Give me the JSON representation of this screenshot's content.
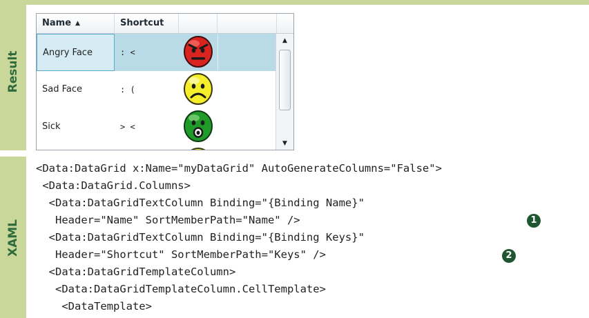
{
  "sections": {
    "result_label": "Result",
    "xaml_label": "XAML"
  },
  "grid": {
    "columns": [
      {
        "header": "Name",
        "sort": "ascending"
      },
      {
        "header": "Shortcut"
      },
      {
        "header": ""
      },
      {
        "header": ""
      }
    ],
    "sort_glyph": "▲",
    "rows": [
      {
        "name": "Angry Face",
        "shortcut": ": <",
        "face": "angry-face-icon",
        "color": "#d8231f",
        "selected": true
      },
      {
        "name": "Sad Face",
        "shortcut": ": (",
        "face": "sad-face-icon",
        "color": "#f5ee2a",
        "selected": false
      },
      {
        "name": "Sick",
        "shortcut": "> <",
        "face": "sick-face-icon",
        "color": "#1f9b2a",
        "selected": false
      }
    ],
    "scroll": {
      "up": "▲",
      "down": "▼"
    }
  },
  "code": {
    "lines": [
      "<Data:DataGrid x:Name=\"myDataGrid\" AutoGenerateColumns=\"False\">",
      " <Data:DataGrid.Columns>",
      "  <Data:DataGridTextColumn Binding=\"{Binding Name}\"",
      "   Header=\"Name\" SortMemberPath=\"Name\" />",
      "  <Data:DataGridTextColumn Binding=\"{Binding Keys}\"",
      "   Header=\"Shortcut\" SortMemberPath=\"Keys\" />",
      "  <Data:DataGridTemplateColumn>",
      "   <Data:DataGridTemplateColumn.CellTemplate>",
      "    <DataTemplate>"
    ],
    "callouts": [
      "1",
      "2"
    ]
  },
  "colors": {
    "sidebar": "#c9d79b",
    "label": "#2f6b3a",
    "selection": "#b9dbe7",
    "callout": "#1e5632"
  }
}
